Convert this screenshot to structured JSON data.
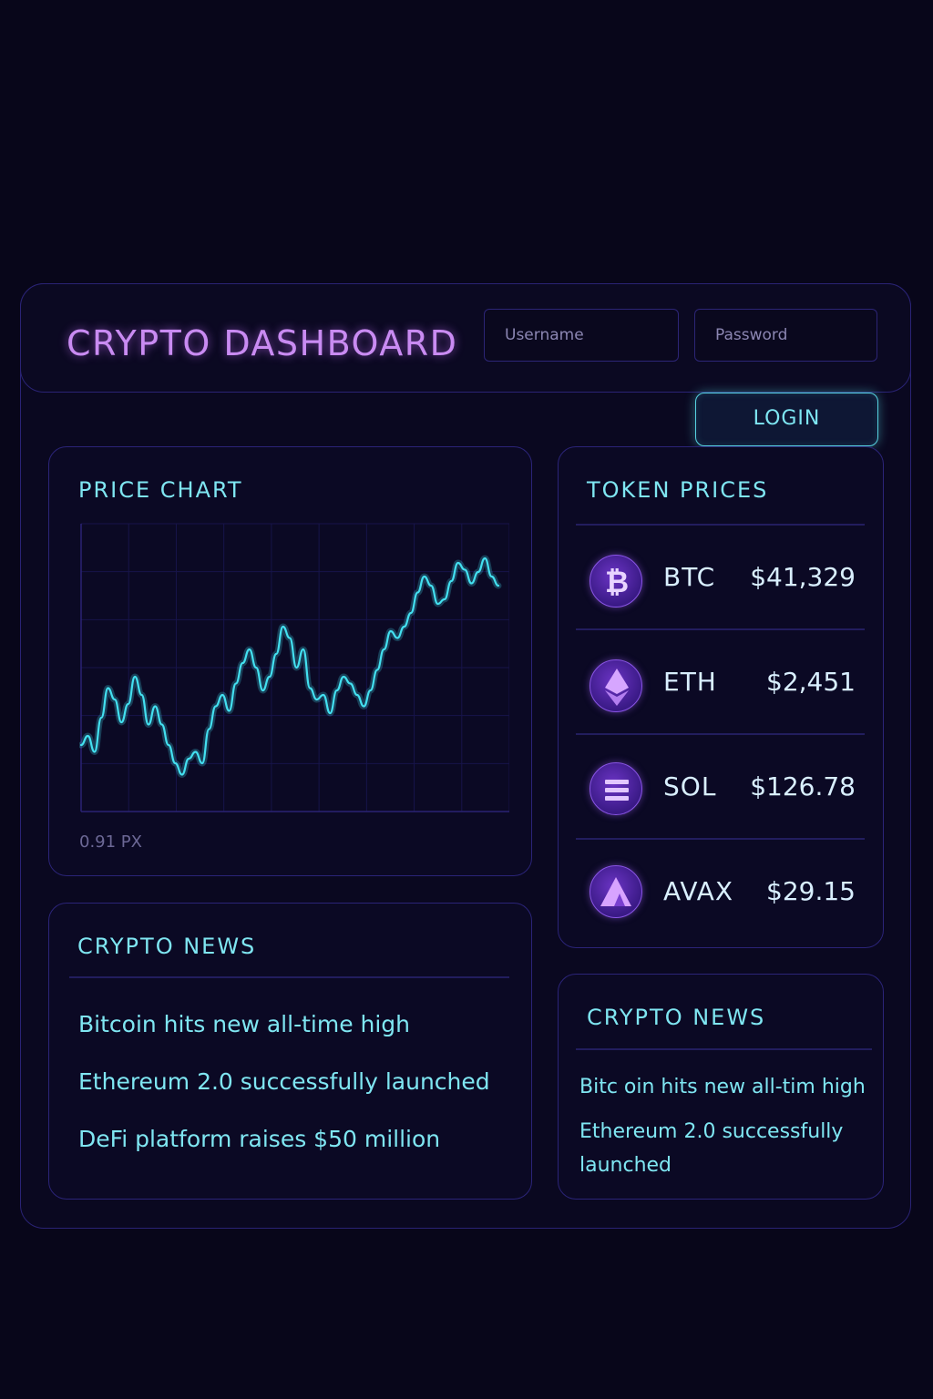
{
  "app": {
    "title": "CRYPTO DASHBOARD"
  },
  "login": {
    "username_placeholder": "Username",
    "password_placeholder": "Password",
    "button_label": "LOGIN"
  },
  "price_chart": {
    "title": "PRICE CHART",
    "footer": "0.91 PX"
  },
  "chart_data": {
    "type": "line",
    "title": "PRICE CHART",
    "xlabel": "",
    "ylabel": "",
    "grid": true,
    "ylim": [
      0,
      100
    ],
    "series": [
      {
        "values": [
          18,
          22,
          15,
          30,
          43,
          38,
          28,
          36,
          48,
          40,
          27,
          35,
          27,
          18,
          10,
          5,
          12,
          15,
          10,
          25,
          35,
          40,
          33,
          45,
          54,
          60,
          52,
          42,
          48,
          58,
          70,
          65,
          52,
          60,
          43,
          38,
          40,
          32,
          42,
          48,
          45,
          40,
          35,
          42,
          51,
          60,
          68,
          65,
          70,
          76,
          85,
          92,
          88,
          80,
          82,
          90,
          98,
          95,
          89,
          94,
          100,
          92,
          88
        ]
      }
    ],
    "color": "#43e0f0"
  },
  "token_prices": {
    "title": "TOKEN PRICES",
    "tokens": [
      {
        "symbol": "BTC",
        "price": "$41,329",
        "icon": "bitcoin-icon"
      },
      {
        "symbol": "ETH",
        "price": "$2,451",
        "icon": "ethereum-icon"
      },
      {
        "symbol": "SOL",
        "price": "$126.78",
        "icon": "solana-icon"
      },
      {
        "symbol": "AVAX",
        "price": "$29.15",
        "icon": "avalanche-icon"
      }
    ]
  },
  "news_main": {
    "title": "CRYPTO NEWS",
    "items": [
      "Bitcoin hits new all-time high",
      "Ethereum 2.0 successfully launched",
      "DeFi platform raises $50 million"
    ]
  },
  "news_side": {
    "title": "CRYPTO NEWS",
    "items": [
      "Bitc oin hits new all-tim high",
      "Ethereum 2.0 successfully",
      "launched"
    ]
  },
  "colors": {
    "background": "#08061a",
    "accent_purple": "#c98bf2",
    "accent_cyan": "#7fe6f2",
    "border": "#2b2478"
  }
}
